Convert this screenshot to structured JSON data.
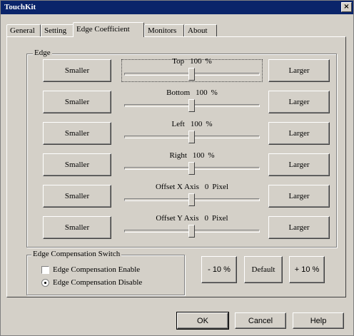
{
  "window": {
    "title": "TouchKit",
    "close_symbol": "×"
  },
  "tabs": [
    {
      "label": "General"
    },
    {
      "label": "Setting"
    },
    {
      "label": "Edge Coefficient"
    },
    {
      "label": "Monitors"
    },
    {
      "label": "About"
    }
  ],
  "active_tab": "Edge Coefficient",
  "edge_group": {
    "label": "Edge"
  },
  "rows": [
    {
      "smaller": "Smaller",
      "name": "Top",
      "value": "100",
      "unit": "%",
      "larger": "Larger",
      "level": 0.5
    },
    {
      "smaller": "Smaller",
      "name": "Bottom",
      "value": "100",
      "unit": "%",
      "larger": "Larger",
      "level": 0.5
    },
    {
      "smaller": "Smaller",
      "name": "Left",
      "value": "100",
      "unit": "%",
      "larger": "Larger",
      "level": 0.5
    },
    {
      "smaller": "Smaller",
      "name": "Right",
      "value": "100",
      "unit": "%",
      "larger": "Larger",
      "level": 0.5
    },
    {
      "smaller": "Smaller",
      "name": "Offset X Axis",
      "value": "0",
      "unit": "Pixel",
      "larger": "Larger",
      "level": 0.5
    },
    {
      "smaller": "Smaller",
      "name": "Offset Y Axis",
      "value": "0",
      "unit": "Pixel",
      "larger": "Larger",
      "level": 0.5
    }
  ],
  "compensation": {
    "label": "Edge Compensation Switch",
    "enable_label": "Edge Compensation Enable",
    "disable_label": "Edge Compensation Disable"
  },
  "adjust_buttons": {
    "minus": "- 10 %",
    "default": "Default",
    "plus": "+ 10 %"
  },
  "footer": {
    "ok": "OK",
    "cancel": "Cancel",
    "help": "Help"
  }
}
